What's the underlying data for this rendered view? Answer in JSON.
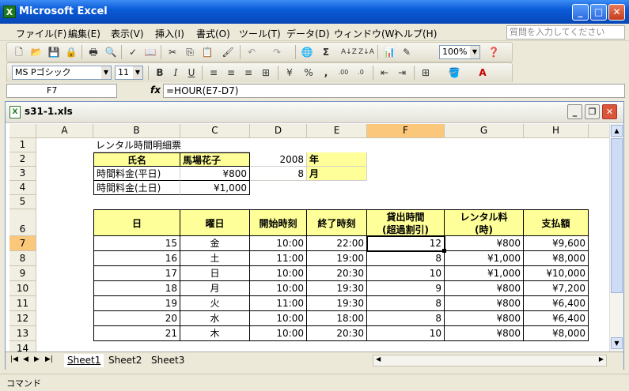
{
  "app": {
    "title": "Microsoft Excel"
  },
  "menu": [
    "ファイル(F)",
    "編集(E)",
    "表示(V)",
    "挿入(I)",
    "書式(O)",
    "ツール(T)",
    "データ(D)",
    "ウィンドウ(W)",
    "ヘルプ(H)"
  ],
  "help_placeholder": "質問を入力してください",
  "toolbar": {
    "zoom": "100%",
    "font": "MS Pゴシック",
    "size": "11"
  },
  "formula_bar": {
    "cell": "F7",
    "formula": "=HOUR(E7-D7)"
  },
  "workbook": {
    "title": "s31-1.xls"
  },
  "columns": [
    "A",
    "B",
    "C",
    "D",
    "E",
    "F",
    "G",
    "H"
  ],
  "rows": [
    "1",
    "2",
    "3",
    "4",
    "5",
    "6",
    "7",
    "8",
    "9",
    "10",
    "11",
    "12",
    "13",
    "14"
  ],
  "sheet": {
    "title": "レンタル時間明細票",
    "name_label": "氏名",
    "name_value": "馬場花子",
    "year_value": "2008",
    "year_label": "年",
    "month_value": "8",
    "month_label": "月",
    "weekday_rate_label": "時間料金(平日)",
    "weekday_rate": "¥800",
    "weekend_rate_label": "時間料金(土日)",
    "weekend_rate": "¥1,000",
    "headers": {
      "day": "日",
      "weekday": "曜日",
      "start": "開始時刻",
      "end": "終了時刻",
      "hours_1": "貸出時間",
      "hours_2": "(超過割引)",
      "rate_1": "レンタル料",
      "rate_2": "(時)",
      "pay": "支払額"
    },
    "records": [
      {
        "day": "15",
        "wd": "金",
        "start": "10:00",
        "end": "22:00",
        "hours": "12",
        "rate": "¥800",
        "pay": "¥9,600"
      },
      {
        "day": "16",
        "wd": "土",
        "start": "11:00",
        "end": "19:00",
        "hours": "8",
        "rate": "¥1,000",
        "pay": "¥8,000"
      },
      {
        "day": "17",
        "wd": "日",
        "start": "10:00",
        "end": "20:30",
        "hours": "10",
        "rate": "¥1,000",
        "pay": "¥10,000"
      },
      {
        "day": "18",
        "wd": "月",
        "start": "10:00",
        "end": "19:30",
        "hours": "9",
        "rate": "¥800",
        "pay": "¥7,200"
      },
      {
        "day": "19",
        "wd": "火",
        "start": "11:00",
        "end": "19:30",
        "hours": "8",
        "rate": "¥800",
        "pay": "¥6,400"
      },
      {
        "day": "20",
        "wd": "水",
        "start": "10:00",
        "end": "18:00",
        "hours": "8",
        "rate": "¥800",
        "pay": "¥6,400"
      },
      {
        "day": "21",
        "wd": "木",
        "start": "10:00",
        "end": "20:30",
        "hours": "10",
        "rate": "¥800",
        "pay": "¥8,000"
      }
    ]
  },
  "tabs": [
    "Sheet1",
    "Sheet2",
    "Sheet3"
  ],
  "status": "コマンド"
}
